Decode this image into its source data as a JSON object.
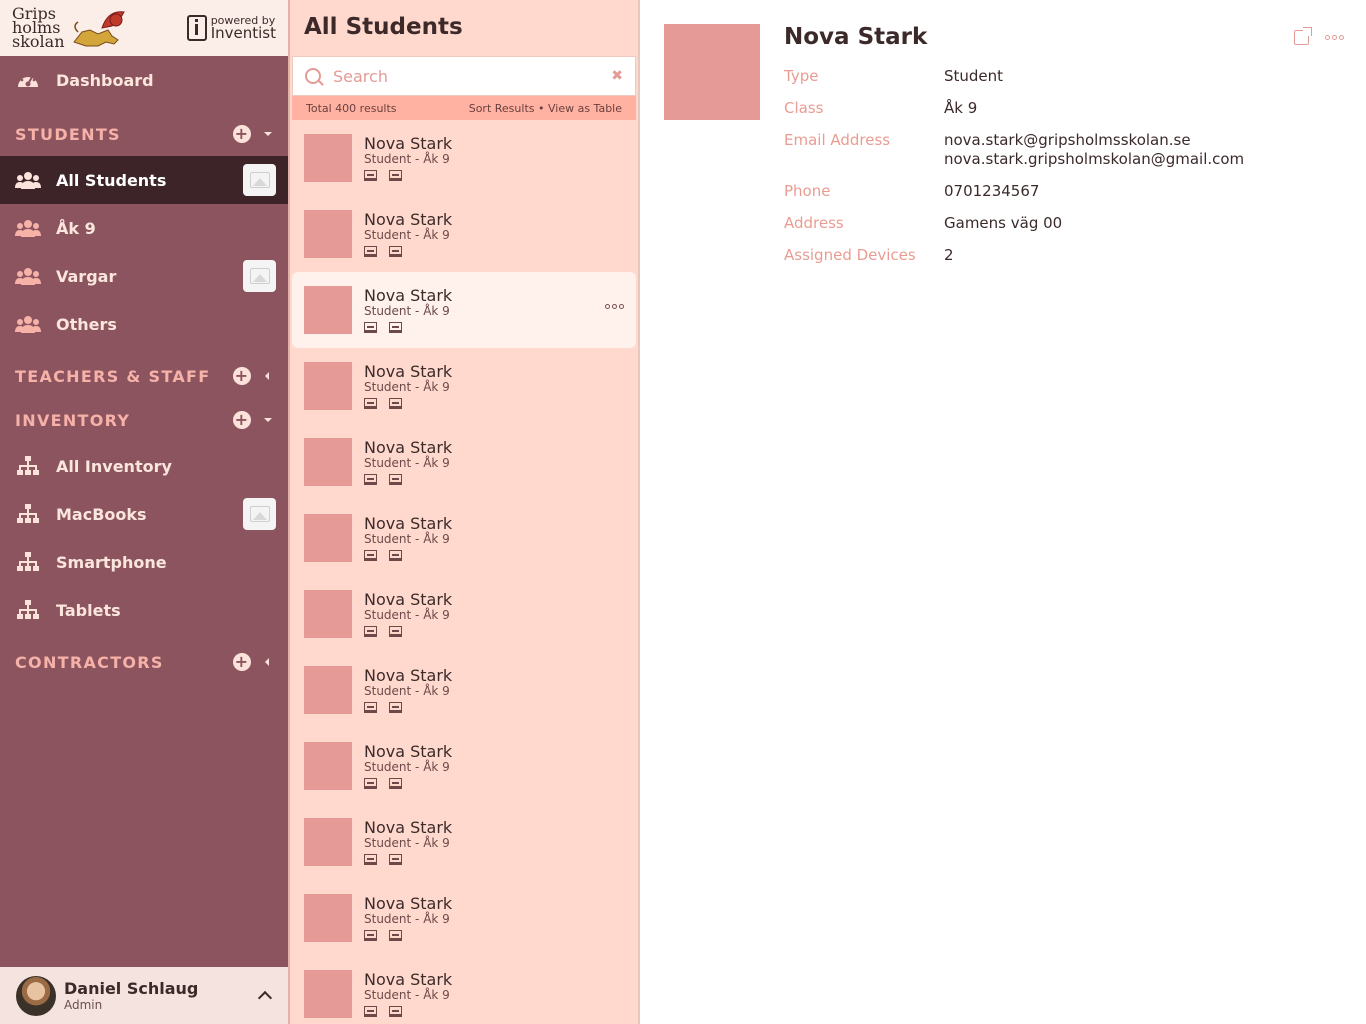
{
  "brand": {
    "school_lines": [
      "Grips",
      "holms",
      "skolan"
    ],
    "powered_by": "powered by",
    "powered_name": "Inventist"
  },
  "nav": {
    "dashboard": "Dashboard",
    "students_header": "STUDENTS",
    "students_items": [
      "All Students",
      "Åk 9",
      "Vargar",
      "Others"
    ],
    "teachers_header": "TEACHERS & STAFF",
    "inventory_header": "INVENTORY",
    "inventory_items": [
      "All Inventory",
      "MacBooks",
      "Smartphone",
      "Tablets"
    ],
    "contractors_header": "CONTRACTORS"
  },
  "user": {
    "name": "Daniel Schlaug",
    "role": "Admin"
  },
  "list": {
    "title": "All Students",
    "search_placeholder": "Search",
    "total": "Total 400 results",
    "sort": "Sort Results",
    "separator": "•",
    "view_table": "View as Table",
    "items": [
      {
        "name": "Nova Stark",
        "sub": "Student - Åk 9"
      },
      {
        "name": "Nova Stark",
        "sub": "Student - Åk 9"
      },
      {
        "name": "Nova Stark",
        "sub": "Student - Åk 9"
      },
      {
        "name": "Nova Stark",
        "sub": "Student - Åk 9"
      },
      {
        "name": "Nova Stark",
        "sub": "Student - Åk 9"
      },
      {
        "name": "Nova Stark",
        "sub": "Student - Åk 9"
      },
      {
        "name": "Nova Stark",
        "sub": "Student - Åk 9"
      },
      {
        "name": "Nova Stark",
        "sub": "Student - Åk 9"
      },
      {
        "name": "Nova Stark",
        "sub": "Student - Åk 9"
      },
      {
        "name": "Nova Stark",
        "sub": "Student - Åk 9"
      },
      {
        "name": "Nova Stark",
        "sub": "Student - Åk 9"
      },
      {
        "name": "Nova Stark",
        "sub": "Student - Åk 9"
      }
    ]
  },
  "detail": {
    "name": "Nova Stark",
    "type_label": "Type",
    "type_value": "Student",
    "class_label": "Class",
    "class_value": "Åk 9",
    "email_label": "Email Address",
    "email_1": "nova.stark@gripsholmsskolan.se",
    "email_2": "nova.stark.gripsholmskolan@gmail.com",
    "phone_label": "Phone",
    "phone_value": "0701234567",
    "address_label": "Address",
    "address_value": "Gamens väg 00",
    "devices_label": "Assigned Devices",
    "devices_value": "2"
  },
  "colors": {
    "sidebar": "#8c545e",
    "sidebar_active": "#3d2428",
    "list_bg": "#ffd9cd",
    "accent": "#e59a98",
    "label": "#ea9c92"
  }
}
